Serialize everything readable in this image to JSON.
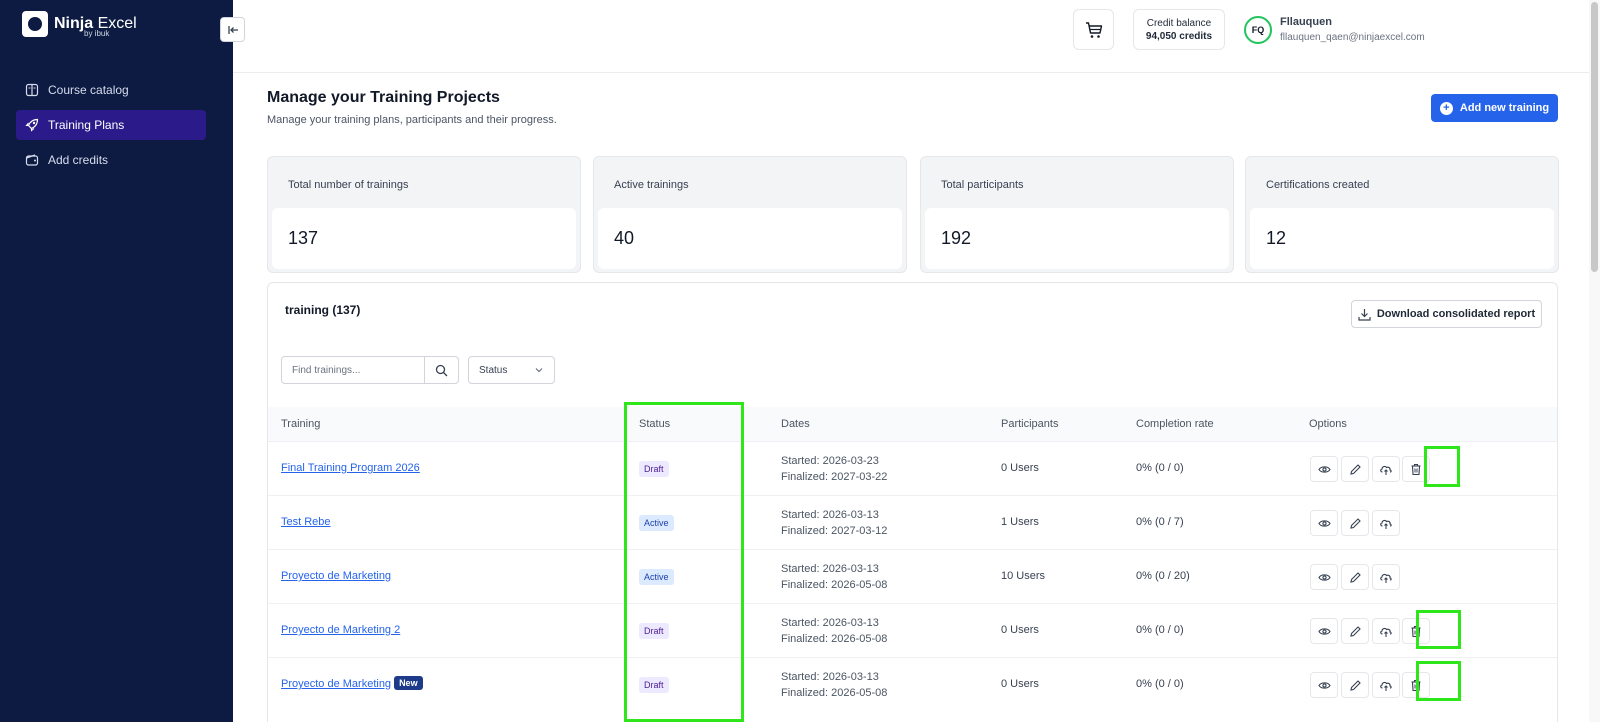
{
  "app": {
    "logo_brand": "Ninja",
    "logo_product": "Excel",
    "logo_by": "by ibuk"
  },
  "sidebar": {
    "items": [
      {
        "label": "Course catalog",
        "icon": "book-icon"
      },
      {
        "label": "Training Plans",
        "icon": "rocket-icon",
        "active": true
      },
      {
        "label": "Add credits",
        "icon": "wallet-icon"
      }
    ]
  },
  "topbar": {
    "credit_label": "Credit balance",
    "credit_value": "94,050 credits",
    "avatar_initials": "FQ",
    "user_name": "Fllauquen",
    "user_email": "fllauquen_qaen@ninjaexcel.com"
  },
  "header": {
    "title": "Manage your Training Projects",
    "subtitle": "Manage your training plans, participants and their progress.",
    "add_button": "Add new training"
  },
  "stats": [
    {
      "label": "Total number of trainings",
      "value": "137"
    },
    {
      "label": "Active trainings",
      "value": "40"
    },
    {
      "label": "Total participants",
      "value": "192"
    },
    {
      "label": "Certifications created",
      "value": "12"
    }
  ],
  "table": {
    "title": "training (137)",
    "download_label": "Download consolidated report",
    "search_placeholder": "Find trainings...",
    "status_filter": "Status",
    "columns": [
      "Training",
      "Status",
      "Dates",
      "Participants",
      "Completion rate",
      "Options"
    ],
    "rows": [
      {
        "name": "Final Training Program 2026",
        "status": "Draft",
        "started": "Started: 2026-03-23",
        "finalized": "Finalized: 2027-03-22",
        "participants": "0 Users",
        "completion": "0% (0 / 0)",
        "deletable": true
      },
      {
        "name": "Test Rebe",
        "status": "Active",
        "started": "Started: 2026-03-13",
        "finalized": "Finalized: 2027-03-12",
        "participants": "1 Users",
        "completion": "0% (0 / 7)",
        "deletable": false
      },
      {
        "name": "Proyecto de Marketing",
        "status": "Active",
        "started": "Started: 2026-03-13",
        "finalized": "Finalized: 2026-05-08",
        "participants": "10 Users",
        "completion": "0% (0 / 20)",
        "deletable": false
      },
      {
        "name": "Proyecto de Marketing 2",
        "status": "Draft",
        "started": "Started: 2026-03-13",
        "finalized": "Finalized: 2026-05-08",
        "participants": "0 Users",
        "completion": "0% (0 / 0)",
        "deletable": true
      },
      {
        "name": "Proyecto de Marketing",
        "badge": "New",
        "status": "Draft",
        "started": "Started: 2026-03-13",
        "finalized": "Finalized: 2026-05-08",
        "participants": "0 Users",
        "completion": "0% (0 / 0)",
        "deletable": true
      }
    ]
  },
  "colors": {
    "sidebar_bg": "#0d1b42",
    "active_nav": "#2b1a8a",
    "primary": "#2563eb",
    "highlight": "#2ee61a"
  }
}
